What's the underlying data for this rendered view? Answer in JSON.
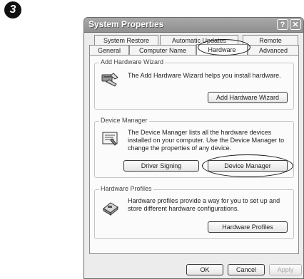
{
  "step_number": "3",
  "window": {
    "title": "System Properties",
    "help_label": "?",
    "close_label": "✕"
  },
  "tabs_row_back": [
    "System Restore",
    "Automatic Updates",
    "Remote"
  ],
  "tabs_row_front": [
    "General",
    "Computer Name",
    "Hardware",
    "Advanced"
  ],
  "active_tab": "Hardware",
  "add_hardware": {
    "legend": "Add Hardware Wizard",
    "description": "The Add Hardware Wizard helps you install hardware.",
    "button": "Add Hardware Wizard",
    "icon": "add-hardware-wizard-icon"
  },
  "device_manager": {
    "legend": "Device Manager",
    "description": "The Device Manager lists all the hardware devices installed on your computer. Use the Device Manager to change the properties of any device.",
    "driver_signing_button": "Driver Signing",
    "device_manager_button": "Device Manager",
    "icon": "device-manager-icon"
  },
  "hardware_profiles": {
    "legend": "Hardware Profiles",
    "description": "Hardware profiles provide a way for you to set up and store different hardware configurations.",
    "button": "Hardware Profiles",
    "icon": "hardware-profiles-icon"
  },
  "footer": {
    "ok": "OK",
    "cancel": "Cancel",
    "apply": "Apply"
  }
}
